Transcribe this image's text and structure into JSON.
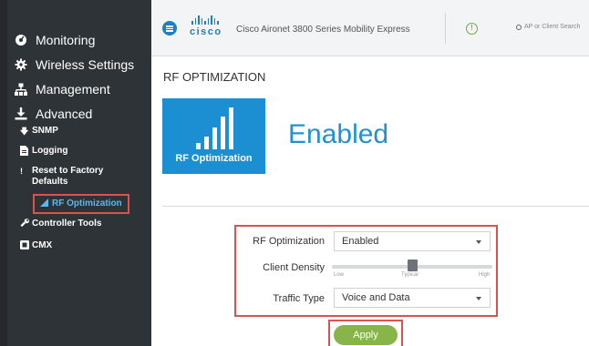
{
  "sidebar": {
    "items": [
      {
        "label": "Monitoring",
        "icon": "dashboard-icon"
      },
      {
        "label": "Wireless Settings",
        "icon": "gear-icon"
      },
      {
        "label": "Management",
        "icon": "sitemap-icon"
      },
      {
        "label": "Advanced",
        "icon": "download-icon"
      }
    ],
    "advanced_items": [
      {
        "label": "SNMP",
        "icon": "arrow-down-icon"
      },
      {
        "label": "Logging",
        "icon": "file-icon"
      },
      {
        "label": "Reset to Factory\nDefaults",
        "icon": "exclamation-icon"
      },
      {
        "label": "RF Optimization",
        "icon": "signal-bars-icon",
        "active": true
      },
      {
        "label": "Controller Tools",
        "icon": "wrench-icon"
      },
      {
        "label": "CMX",
        "icon": "cmx-icon"
      }
    ]
  },
  "header": {
    "brand": "cisco",
    "product": "Cisco Aironet 3800 Series Mobility Express",
    "search_placeholder": "AP or Client Search"
  },
  "main": {
    "title": "RF OPTIMIZATION",
    "tile_label": "RF Optimization",
    "status": "Enabled",
    "form": {
      "rf_opt_label": "RF Optimization",
      "rf_opt_value": "Enabled",
      "density_label": "Client Density",
      "density_ticks": [
        "Low",
        "Typical",
        "High"
      ],
      "density_level": 0.5,
      "traffic_label": "Traffic Type",
      "traffic_value": "Voice and Data"
    },
    "apply_label": "Apply"
  },
  "colors": {
    "sidebar_bg": "#2e3338",
    "accent_blue": "#1b8fd2",
    "highlight_red": "#d9534f",
    "apply_green": "#88b54a"
  }
}
